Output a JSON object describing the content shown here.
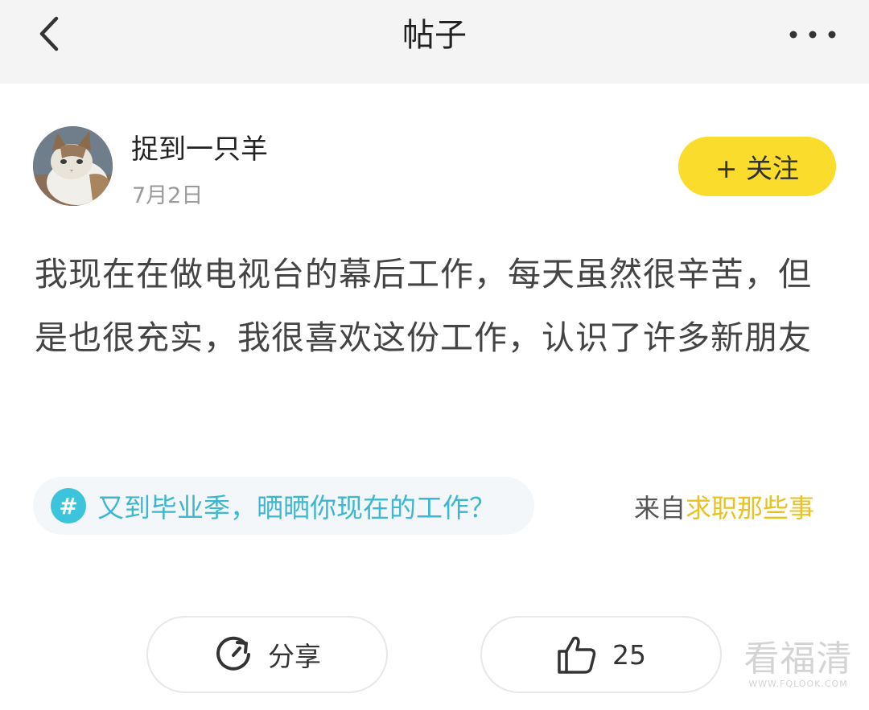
{
  "header": {
    "title": "帖子",
    "back_icon": "chevron-left-icon",
    "more_icon": "more-horizontal-icon"
  },
  "author": {
    "name": "捉到一只羊",
    "date": "7月2日",
    "avatar_icon": "cat-avatar"
  },
  "follow_button": {
    "label": "+ 关注",
    "color": "#f9dc2c"
  },
  "post": {
    "text": "我现在在做电视台的幕后工作，每天虽然很辛苦，但是也很充实，我很喜欢这份工作，认识了许多新朋友"
  },
  "topic": {
    "icon": "hashtag-icon",
    "text": "又到毕业季，晒晒你现在的工作？",
    "color": "#3bb8d0"
  },
  "source": {
    "prefix": "来自",
    "name": "求职那些事",
    "color": "#e8c21e"
  },
  "actions": {
    "share_label": "分享",
    "share_icon": "share-refresh-icon",
    "like_count": "25",
    "like_icon": "thumbs-up-icon"
  },
  "watermark": {
    "main": "看福清",
    "url": "WWW.FQLOOK.COM"
  }
}
